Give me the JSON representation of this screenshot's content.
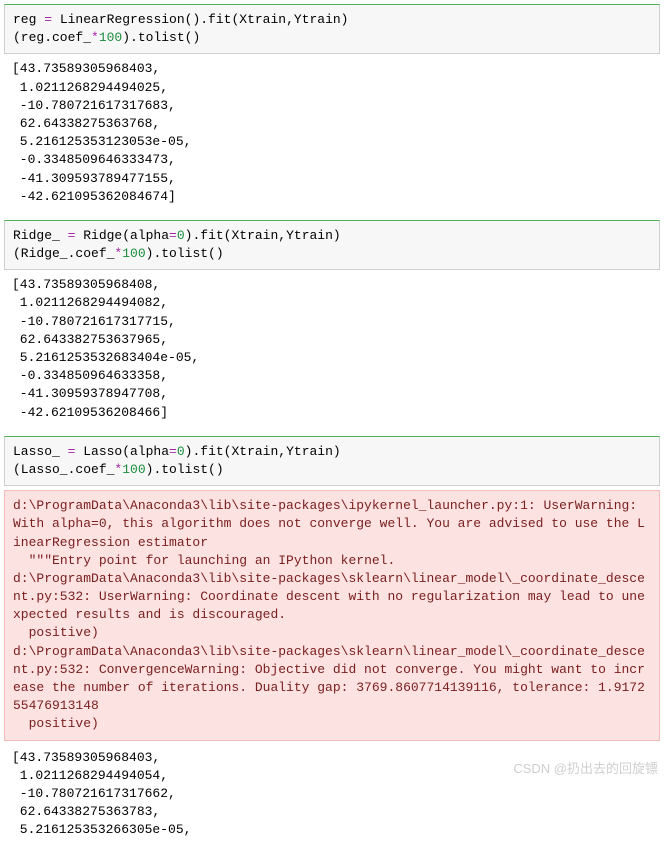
{
  "cells": [
    {
      "code_tokens": [
        {
          "t": "reg ",
          "c": ""
        },
        {
          "t": "=",
          "c": "tok-op"
        },
        {
          "t": " LinearRegression().fit(Xtrain,Ytrain)\n(reg.coef_",
          "c": ""
        },
        {
          "t": "*",
          "c": "tok-op"
        },
        {
          "t": "100",
          "c": "tok-num"
        },
        {
          "t": ").tolist()",
          "c": ""
        }
      ],
      "output": "[43.73589305968403,\n 1.0211268294494025,\n -10.780721617317683,\n 62.64338275363768,\n 5.216125353123053e-05,\n -0.3348509646333473,\n -41.30959378947715S,\n -42.62109536208467​4]"
    },
    {
      "code_tokens": [
        {
          "t": "Ridge_ ",
          "c": ""
        },
        {
          "t": "=",
          "c": "tok-op"
        },
        {
          "t": " Ridge(alpha",
          "c": ""
        },
        {
          "t": "=",
          "c": "tok-op"
        },
        {
          "t": "0",
          "c": "tok-num"
        },
        {
          "t": ").fit(Xtrain,Ytrain)\n(Ridge_.coef_",
          "c": ""
        },
        {
          "t": "*",
          "c": "tok-op"
        },
        {
          "t": "100",
          "c": "tok-num"
        },
        {
          "t": ").tolist()",
          "c": ""
        }
      ],
      "output": "[43.73589305968408,\n 1.0211268294494082,\n -10.780721617317715,\n 62.643382753637965,\n 5.2161253532683404e-05,\n -0.334850964633358,\n -41.30959378947708,\n -42.62109536208466]"
    },
    {
      "code_tokens": [
        {
          "t": "Lasso_ ",
          "c": ""
        },
        {
          "t": "=",
          "c": "tok-op"
        },
        {
          "t": " Lasso(alpha",
          "c": ""
        },
        {
          "t": "=",
          "c": "tok-op"
        },
        {
          "t": "0",
          "c": "tok-num"
        },
        {
          "t": ").fit(Xtrain,Ytrain)\n(Lasso_.coef_",
          "c": ""
        },
        {
          "t": "*",
          "c": "tok-op"
        },
        {
          "t": "100",
          "c": "tok-num"
        },
        {
          "t": ").tolist()",
          "c": ""
        }
      ],
      "warning": "d:\\ProgramData\\Anaconda3\\lib\\site-packages\\ipykernel_launcher.py:1: UserWarning: With alpha=0, this algorithm does not converge well. You are advised to use the LinearRegression estimator\n  \"\"\"Entry point for launching an IPython kernel.\nd:\\ProgramData\\Anaconda3\\lib\\site-packages\\sklearn\\linear_model\\_coordinate_descent.py:532: UserWarning: Coordinate descent with no regularization may lead to unexpected results and is discouraged.\n  positive)\nd:\\ProgramData\\Anaconda3\\lib\\site-packages\\sklearn\\linear_model\\_coordinate_descent.py:532: ConvergenceWarning: Objective did not converge. You might want to increase the number of iterations. Duality gap: 3769.8607714139116, tolerance: 1.917255476913148\n  positive)",
      "output": "[43.73589305968403,\n 1.0211268294494054,\n -10.780721617317662,\n 62.64338275363783,\n 5.216125353266305e-05,"
    }
  ],
  "cell1_output": "[43.73589305968403,\n 1.0211268294494025,\n -10.780721617317683,\n 62.64338275363768,\n 5.216125353123053e-05,\n -0.3348509646333473,\n -41.309593789477155,\n -42.621095362084674]",
  "cell2_output": "[43.73589305968408,\n 1.0211268294494082,\n -10.780721617317715,\n 62.643382753637965,\n 5.2161253532683404e-05,\n -0.334850964633358,\n -41.30959378947708,\n -42.62109536208466]",
  "cell3_output": "[43.73589305968403,\n 1.0211268294494054,\n -10.780721617317662,\n 62.64338275363783,\n 5.216125353266305e-05,",
  "watermark": "CSDN @扔出去的回旋镖"
}
